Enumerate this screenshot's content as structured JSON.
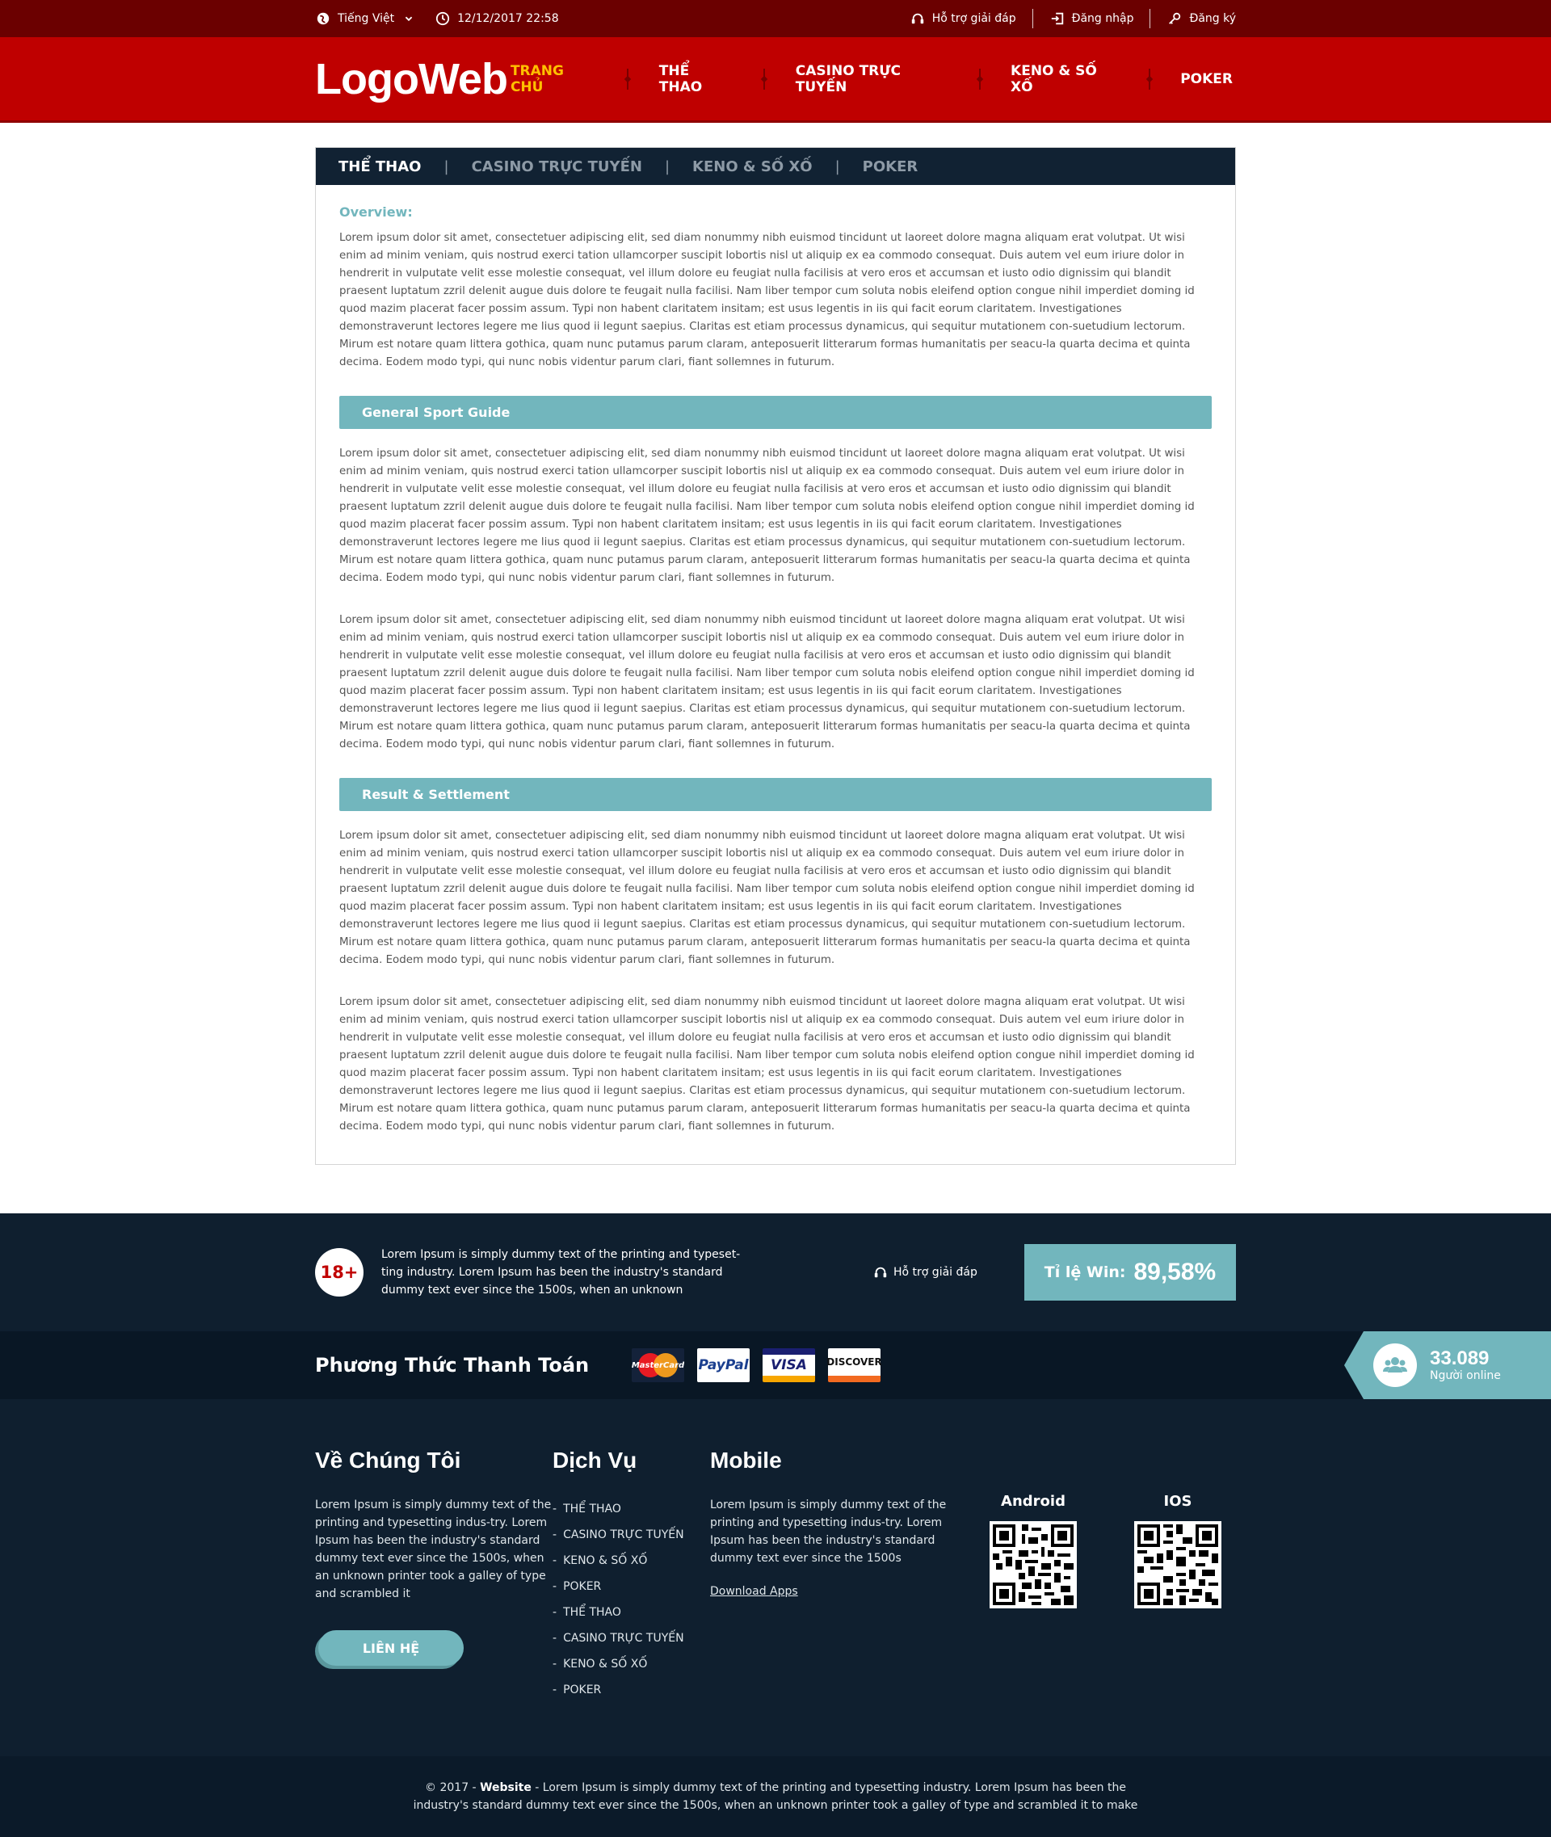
{
  "topbar": {
    "language": "Tiếng Việt",
    "datetime": "12/12/2017 22:58",
    "support": "Hỗ trợ giải đáp",
    "login": "Đăng nhập",
    "register": "Đăng ký"
  },
  "header": {
    "logo": "LogoWeb",
    "nav": [
      "TRANG CHỦ",
      "THỂ THAO",
      "CASINO TRỰC TUYẾN",
      "KENO & SỐ XỐ",
      "POKER"
    ]
  },
  "content": {
    "tabs": [
      "THỂ THAO",
      "CASINO TRỰC TUYẾN",
      "KENO & SỐ XỐ",
      "POKER"
    ],
    "tab_separator": "|",
    "overview_title": "Overview:",
    "paragraph": "Lorem ipsum dolor sit amet, consectetuer adipiscing elit, sed diam nonummy nibh euismod tincidunt ut laoreet dolore magna aliquam erat volutpat. Ut wisi enim ad minim veniam, quis nostrud exerci tation ullamcorper suscipit lobortis nisl ut aliquip ex ea commodo consequat. Duis autem vel eum iriure dolor in hendrerit in vulputate velit esse molestie consequat, vel illum dolore eu feugiat nulla facilisis at vero eros et accumsan et iusto odio dignissim qui blandit praesent luptatum zzril delenit augue duis dolore te feugait nulla facilisi. Nam liber tempor cum soluta nobis eleifend option congue nihil imperdiet doming id quod mazim placerat facer possim assum. Typi non habent claritatem insitam; est usus legentis in iis qui facit eorum claritatem. Investigationes demonstraverunt lectores legere me lius quod ii legunt saepius. Claritas est etiam processus dynamicus, qui sequitur mutationem con-suetudium lectorum. Mirum est notare quam littera gothica, quam nunc putamus parum claram, anteposuerit litterarum formas humanitatis per seacu-la quarta decima et quinta decima. Eodem modo typi, qui nunc nobis videntur parum clari, fiant sollemnes in futurum.",
    "section1_title": "General Sport Guide",
    "section2_title": "Result & Settlement"
  },
  "footer_top": {
    "age_badge": "18+",
    "age_text": "Lorem Ipsum is simply dummy text of the printing and typeset-ting industry. Lorem Ipsum has been the industry's standard dummy text ever since the 1500s, when an unknown",
    "support": "Hỗ trợ giải đáp",
    "win_label": "Tỉ lệ Win:",
    "win_value": "89,58%"
  },
  "payment": {
    "title": "Phương Thức Thanh Toán",
    "cards": [
      "MasterCard",
      "PayPal",
      "VISA",
      "DISCOVER"
    ],
    "online_count": "33.089",
    "online_label": "Người online"
  },
  "footer": {
    "about_title": "Về Chúng Tôi",
    "about_text": "Lorem Ipsum is simply dummy text of the printing and typesetting indus-try. Lorem Ipsum has been the industry's standard dummy text ever since the 1500s, when an unknown printer took a galley of type and scrambled it",
    "contact_button": "LIÊN HỆ",
    "services_title": "Dịch Vụ",
    "services": [
      "THỂ THAO",
      "CASINO TRỰC TUYẾN",
      "KENO & SỐ XỐ",
      "POKER",
      "THỂ THAO",
      "CASINO TRỰC TUYẾN",
      "KENO & SỐ XỐ",
      "POKER"
    ],
    "mobile_title": "Mobile",
    "mobile_text": "Lorem Ipsum is simply dummy text of the printing and typesetting indus-try. Lorem Ipsum has been the industry's standard dummy text ever since the 1500s",
    "download_link": "Download Apps",
    "android_label": "Android",
    "ios_label": "IOS"
  },
  "copyright": {
    "prefix": "© 2017 - ",
    "site": "Website",
    "text": " - Lorem Ipsum is simply dummy text of the printing and typesetting industry. Lorem Ipsum has been the industry's standard dummy text ever since the 1500s, when an unknown printer took a galley of type and scrambled it to make"
  },
  "colors": {
    "topbar": "#6b0000",
    "header": "#bf0000",
    "accent": "#72b6bd",
    "nav_active": "#ffc000",
    "footer": "#0f1f2f"
  }
}
